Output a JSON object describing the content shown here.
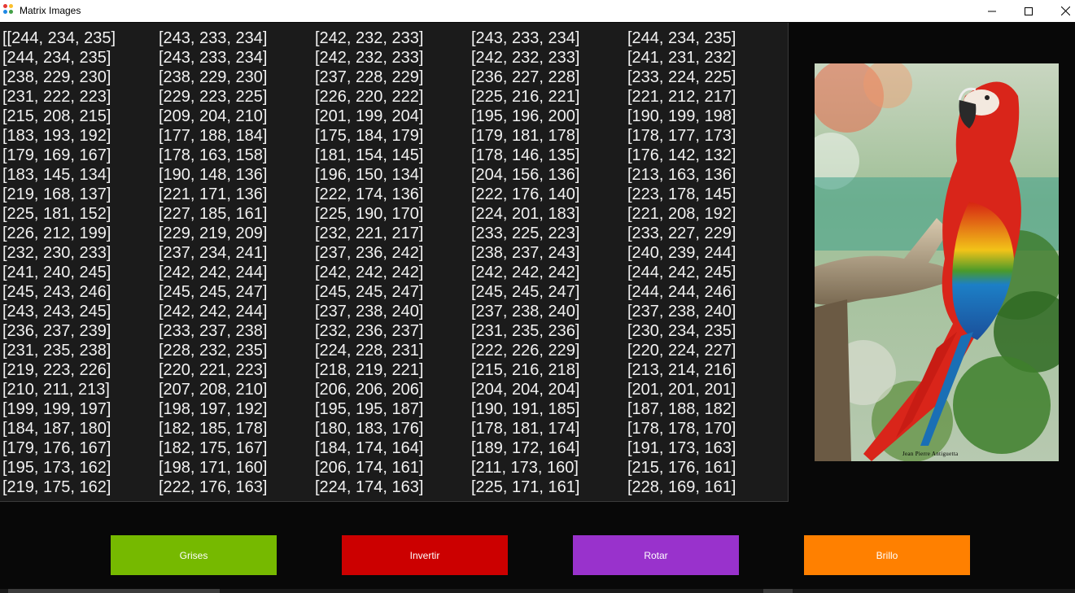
{
  "window": {
    "title": "Matrix Images",
    "controls": {
      "minimize": "—",
      "maximize": "☐",
      "close": "✕"
    }
  },
  "matrix": {
    "rows": [
      [
        "[[244, 234, 235]",
        "[243, 233, 234]",
        "[242, 232, 233]",
        "[243, 233, 234]",
        "[244, 234, 235]"
      ],
      [
        "[244, 234, 235]",
        "[243, 233, 234]",
        "[242, 232, 233]",
        "[242, 232, 233]",
        "[241, 231, 232]"
      ],
      [
        "[238, 229, 230]",
        "[238, 229, 230]",
        "[237, 228, 229]",
        "[236, 227, 228]",
        "[233, 224, 225]"
      ],
      [
        "[231, 222, 223]",
        "[229, 223, 225]",
        "[226, 220, 222]",
        "[225, 216, 221]",
        "[221, 212, 217]"
      ],
      [
        "[215, 208, 215]",
        "[209, 204, 210]",
        "[201, 199, 204]",
        "[195, 196, 200]",
        "[190, 199, 198]"
      ],
      [
        "[183, 193, 192]",
        "[177, 188, 184]",
        "[175, 184, 179]",
        "[179, 181, 178]",
        "[178, 177, 173]"
      ],
      [
        "[179, 169, 167]",
        "[178, 163, 158]",
        "[181, 154, 145]",
        "[178, 146, 135]",
        "[176, 142, 132]"
      ],
      [
        "[183, 145, 134]",
        "[190, 148, 136]",
        "[196, 150, 134]",
        "[204, 156, 136]",
        "[213, 163, 136]"
      ],
      [
        "[219, 168, 137]",
        "[221, 171, 136]",
        "[222, 174, 136]",
        "[222, 176, 140]",
        "[223, 178, 145]"
      ],
      [
        "[225, 181, 152]",
        "[227, 185, 161]",
        "[225, 190, 170]",
        "[224, 201, 183]",
        "[221, 208, 192]"
      ],
      [
        "[226, 212, 199]",
        "[229, 219, 209]",
        "[232, 221, 217]",
        "[233, 225, 223]",
        "[233, 227, 229]"
      ],
      [
        "[232, 230, 233]",
        "[237, 234, 241]",
        "[237, 236, 242]",
        "[238, 237, 243]",
        "[240, 239, 244]"
      ],
      [
        "[241, 240, 245]",
        "[242, 242, 244]",
        "[242, 242, 242]",
        "[242, 242, 242]",
        "[244, 242, 245]"
      ],
      [
        "[245, 243, 246]",
        "[245, 245, 247]",
        "[245, 245, 247]",
        "[245, 245, 247]",
        "[244, 244, 246]"
      ],
      [
        "[243, 243, 245]",
        "[242, 242, 244]",
        "[237, 238, 240]",
        "[237, 238, 240]",
        "[237, 238, 240]"
      ],
      [
        "[236, 237, 239]",
        "[233, 237, 238]",
        "[232, 236, 237]",
        "[231, 235, 236]",
        "[230, 234, 235]"
      ],
      [
        "[231, 235, 238]",
        "[228, 232, 235]",
        "[224, 228, 231]",
        "[222, 226, 229]",
        "[220, 224, 227]"
      ],
      [
        "[219, 223, 226]",
        "[220, 221, 223]",
        "[218, 219, 221]",
        "[215, 216, 218]",
        "[213, 214, 216]"
      ],
      [
        "[210, 211, 213]",
        "[207, 208, 210]",
        "[206, 206, 206]",
        "[204, 204, 204]",
        "[201, 201, 201]"
      ],
      [
        "[199, 199, 197]",
        "[198, 197, 192]",
        "[195, 195, 187]",
        "[190, 191, 185]",
        "[187, 188, 182]"
      ],
      [
        "[184, 187, 180]",
        "[182, 185, 178]",
        "[180, 183, 176]",
        "[178, 181, 174]",
        "[178, 178, 170]"
      ],
      [
        "[179, 176, 167]",
        "[182, 175, 167]",
        "[184, 174, 164]",
        "[189, 172, 164]",
        "[191, 173, 163]"
      ],
      [
        "[195, 173, 162]",
        "[198, 171, 160]",
        "[206, 174, 161]",
        "[211, 173, 160]",
        "[215, 176, 161]"
      ],
      [
        "[219, 175, 162]",
        "[222, 176, 163]",
        "[224, 174, 163]",
        "[225, 171, 161]",
        "[228, 169, 161]"
      ]
    ]
  },
  "image": {
    "credit": "Jean Pierre Antiguetta"
  },
  "buttons": [
    {
      "label": "Grises",
      "color": "#76b900",
      "name": "grises-button"
    },
    {
      "label": "Invertir",
      "color": "#cc0000",
      "name": "invertir-button"
    },
    {
      "label": "Rotar",
      "color": "#9932cc",
      "name": "rotar-button"
    },
    {
      "label": "Brillo",
      "color": "#ff8000",
      "name": "brillo-button"
    }
  ]
}
